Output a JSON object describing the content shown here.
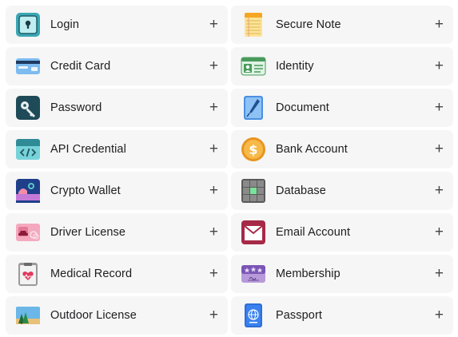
{
  "items": [
    {
      "label": "Login",
      "icon": "login-icon",
      "action": "+"
    },
    {
      "label": "Secure Note",
      "icon": "secure-note-icon",
      "action": "+"
    },
    {
      "label": "Credit Card",
      "icon": "credit-card-icon",
      "action": "+"
    },
    {
      "label": "Identity",
      "icon": "identity-icon",
      "action": "+"
    },
    {
      "label": "Password",
      "icon": "password-icon",
      "action": "+"
    },
    {
      "label": "Document",
      "icon": "document-icon",
      "action": "+"
    },
    {
      "label": "API Credential",
      "icon": "api-credential-icon",
      "action": "+"
    },
    {
      "label": "Bank Account",
      "icon": "bank-account-icon",
      "action": "+"
    },
    {
      "label": "Crypto Wallet",
      "icon": "crypto-wallet-icon",
      "action": "+"
    },
    {
      "label": "Database",
      "icon": "database-icon",
      "action": "+"
    },
    {
      "label": "Driver License",
      "icon": "driver-license-icon",
      "action": "+"
    },
    {
      "label": "Email Account",
      "icon": "email-account-icon",
      "action": "+"
    },
    {
      "label": "Medical Record",
      "icon": "medical-record-icon",
      "action": "+"
    },
    {
      "label": "Membership",
      "icon": "membership-icon",
      "action": "+"
    },
    {
      "label": "Outdoor License",
      "icon": "outdoor-license-icon",
      "action": "+"
    },
    {
      "label": "Passport",
      "icon": "passport-icon",
      "action": "+"
    }
  ],
  "colors": {
    "card_background": "#f6f6f6",
    "label_text": "#1d1d1f",
    "plus_text": "#444444"
  }
}
